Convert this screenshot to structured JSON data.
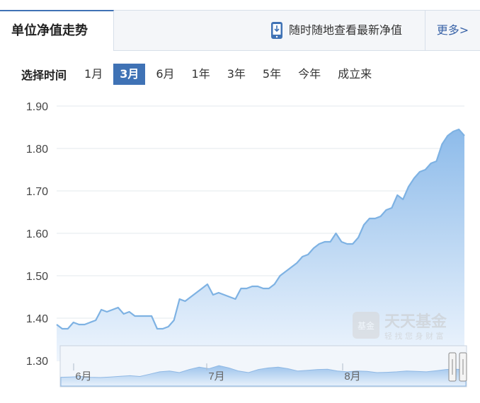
{
  "header": {
    "tab_title": "单位净值走势",
    "promo_text": "随时随地查看最新净值",
    "more_label": "更多>"
  },
  "range_selector": {
    "label": "选择时间",
    "options": [
      "1月",
      "3月",
      "6月",
      "1年",
      "3年",
      "5年",
      "今年",
      "成立来"
    ],
    "active": "3月"
  },
  "watermark": {
    "badge": "基金",
    "name": "天天基金",
    "slogan": "轻 找 您 身 财 富"
  },
  "colors": {
    "line": "#7eb2e3",
    "fill_top": "#8dbbea",
    "fill_bottom": "#eef5fd",
    "grid": "#e3e8ee",
    "active_tab": "#3f72b5"
  },
  "chart_data": {
    "type": "area",
    "title": "",
    "xlabel": "",
    "ylabel": "",
    "ylim": [
      1.3,
      1.9
    ],
    "yticks": [
      "1.90",
      "1.80",
      "1.70",
      "1.60",
      "1.50",
      "1.40",
      "1.30"
    ],
    "x_labels": [
      "6月",
      "7月",
      "8月"
    ],
    "grid": true,
    "series": [
      {
        "values": [
          1.385,
          1.375,
          1.375,
          1.39,
          1.385,
          1.385,
          1.39,
          1.395,
          1.42,
          1.415,
          1.42,
          1.425,
          1.41,
          1.415,
          1.405,
          1.405,
          1.405,
          1.405,
          1.375,
          1.375,
          1.38,
          1.395,
          1.445,
          1.44,
          1.45,
          1.46,
          1.47,
          1.48,
          1.455,
          1.46,
          1.455,
          1.45,
          1.445,
          1.47,
          1.47,
          1.475,
          1.475,
          1.47,
          1.47,
          1.48,
          1.5,
          1.51,
          1.52,
          1.53,
          1.545,
          1.55,
          1.565,
          1.575,
          1.58,
          1.58,
          1.6,
          1.58,
          1.575,
          1.575,
          1.59,
          1.62,
          1.635,
          1.635,
          1.64,
          1.655,
          1.66,
          1.69,
          1.68,
          1.71,
          1.73,
          1.745,
          1.75,
          1.765,
          1.77,
          1.81,
          1.83,
          1.84,
          1.845,
          1.83
        ]
      }
    ]
  }
}
